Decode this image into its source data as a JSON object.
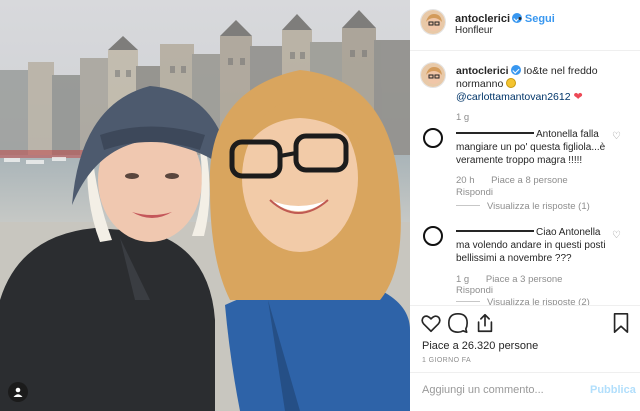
{
  "post": {
    "username": "antoclerici",
    "follow_label": "Segui",
    "location": "Honfleur",
    "caption": {
      "username": "antoclerici",
      "text": "Io&te nel freddo normanno",
      "mention": "@carlottamantovan2612",
      "heart": "❤",
      "age": "1 g"
    },
    "comments": [
      {
        "text": "Antonella falla mangiare un po' questa figliola...è veramente troppo magra !!!!!",
        "time": "20 h",
        "likes": "Piace a 8 persone",
        "reply": "Rispondi",
        "view_replies": "Visualizza le risposte (1)"
      },
      {
        "text": "Ciao Antonella ma volendo andare in questi posti bellissimi a novembre ???",
        "time": "1 g",
        "likes": "Piace a 3 persone",
        "reply": "Rispondi",
        "view_replies": "Visualizza le risposte (2)"
      }
    ],
    "likes_label": "Piace a 26.320 persone",
    "date_label": "1 GIORNO FA",
    "comment_placeholder": "Aggiungi un commento...",
    "publish_label": "Pubblica"
  },
  "icons": [
    "heart-icon",
    "comment-icon",
    "share-icon",
    "bookmark-icon",
    "user-tag-icon",
    "verified-icon"
  ],
  "colors": {
    "accent": "#3897f0",
    "mention": "#003569",
    "muted": "#8e8e8e",
    "heart": "#ed4956"
  }
}
